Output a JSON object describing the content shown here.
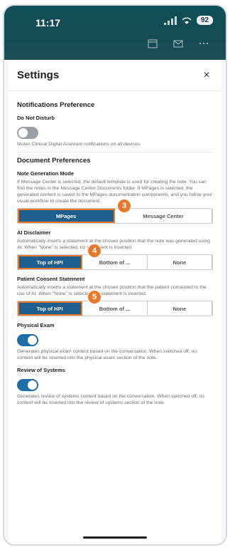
{
  "status_bar": {
    "time": "11:17",
    "battery": "92"
  },
  "sheet": {
    "title": "Settings",
    "close": "×"
  },
  "notifications": {
    "section_title": "Notifications Preference",
    "dnd_label": "Do Not Disturb",
    "dnd_desc": "Mutes Clinical Digital Assistant notifications on all devices.",
    "dnd_on": false
  },
  "document": {
    "section_title": "Document Preferences",
    "note_mode": {
      "label": "Note Generation Mode",
      "desc": "If Message Center is selected, the default template is used for creating the note. You can find the notes in the Message Center Documents folder. If MPages is selected, the generated content is saved to the MPages documentation components, and you follow your usual workflow to create the document.",
      "options": [
        "MPages",
        "Message Center"
      ],
      "selected": "MPages",
      "callout": "3"
    },
    "ai_disclaimer": {
      "label": "AI Disclaimer",
      "desc": "Automatically inserts a statement at the chosen position that the note was generated using AI. When \"None\" is selected, no statement is inserted.",
      "options": [
        "Top of HPI",
        "Bottom of ...",
        "None"
      ],
      "selected": "Top of HPI",
      "callout": "4"
    },
    "patient_consent": {
      "label": "Patient Consent Statement",
      "desc": "Automatically inserts a statement at the chosen position that the patient consented to the use of AI. When \"None\" is selected, no statement is inserted.",
      "options": [
        "Top of HPI",
        "Bottom of ...",
        "None"
      ],
      "selected": "Top of HPI",
      "callout": "5"
    },
    "physical_exam": {
      "label": "Physical Exam",
      "desc": "Generates physical exam content based on the conversation. When switched off, no content will be inserted into the physical exam section of the note.",
      "on": true
    },
    "review_systems": {
      "label": "Review of Systems",
      "desc": "Generates review of systems content based on the conversation. When switched off, no content will be inserted into the review of systems section of the note.",
      "on": true
    }
  },
  "icons": {
    "calendar": "calendar-icon",
    "mail": "mail-icon",
    "more": "more-icon"
  },
  "colors": {
    "header_bg": "#134c55",
    "accent": "#1e5f8f",
    "toggle_on": "#1f6ea8",
    "callout": "#e8792b"
  }
}
